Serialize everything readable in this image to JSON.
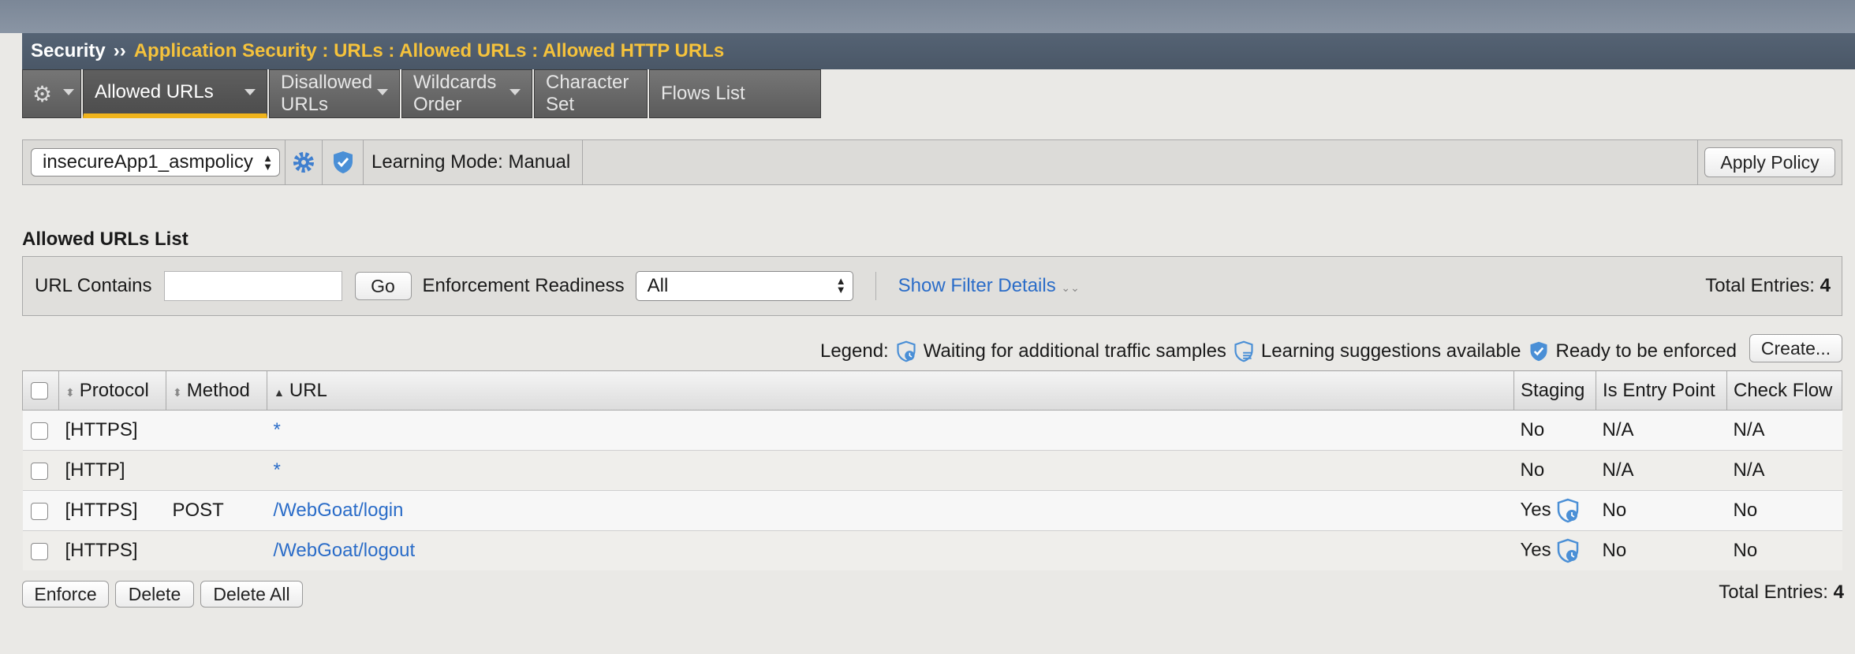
{
  "breadcrumb": {
    "root": "Security",
    "separator": "››",
    "path": "Application Security : URLs : Allowed URLs : Allowed HTTP URLs"
  },
  "tabs": [
    {
      "label": "Allowed URLs",
      "active": true,
      "has_menu": true
    },
    {
      "label": "Disallowed URLs",
      "active": false,
      "has_menu": true
    },
    {
      "label": "Wildcards Order",
      "active": false,
      "has_menu": true
    },
    {
      "label": "Character Set",
      "active": false,
      "has_menu": false
    },
    {
      "label": "Flows List",
      "active": false,
      "has_menu": false
    }
  ],
  "policy": {
    "selected": "insecureApp1_asmpolicy",
    "learning_mode": "Learning Mode: Manual",
    "apply_label": "Apply Policy"
  },
  "list": {
    "title": "Allowed URLs List"
  },
  "filter": {
    "url_contains_label": "URL Contains",
    "url_contains_value": "",
    "go_label": "Go",
    "readiness_label": "Enforcement Readiness",
    "readiness_value": "All",
    "show_filter_label": "Show Filter Details",
    "total_label": "Total Entries:",
    "total_value": "4"
  },
  "legend": {
    "label": "Legend:",
    "waiting": "Waiting for additional traffic samples",
    "learning": "Learning suggestions available",
    "ready": "Ready to be enforced",
    "create_label": "Create..."
  },
  "table": {
    "headers": {
      "protocol": "Protocol",
      "method": "Method",
      "url": "URL",
      "staging": "Staging",
      "entry": "Is Entry Point",
      "flow": "Check Flow"
    },
    "rows": [
      {
        "protocol": "[HTTPS]",
        "method": "",
        "url": "*",
        "staging": "No",
        "staging_icon": false,
        "entry": "N/A",
        "flow": "N/A"
      },
      {
        "protocol": "[HTTP]",
        "method": "",
        "url": "*",
        "staging": "No",
        "staging_icon": false,
        "entry": "N/A",
        "flow": "N/A"
      },
      {
        "protocol": "[HTTPS]",
        "method": "POST",
        "url": "/WebGoat/login",
        "staging": "Yes",
        "staging_icon": true,
        "entry": "No",
        "flow": "No"
      },
      {
        "protocol": "[HTTPS]",
        "method": "",
        "url": "/WebGoat/logout",
        "staging": "Yes",
        "staging_icon": true,
        "entry": "No",
        "flow": "No"
      }
    ]
  },
  "actions": {
    "enforce": "Enforce",
    "delete": "Delete",
    "delete_all": "Delete All"
  },
  "colors": {
    "accent": "#f0b41c",
    "link": "#2a6cc8",
    "shield": "#4a8fd6"
  }
}
